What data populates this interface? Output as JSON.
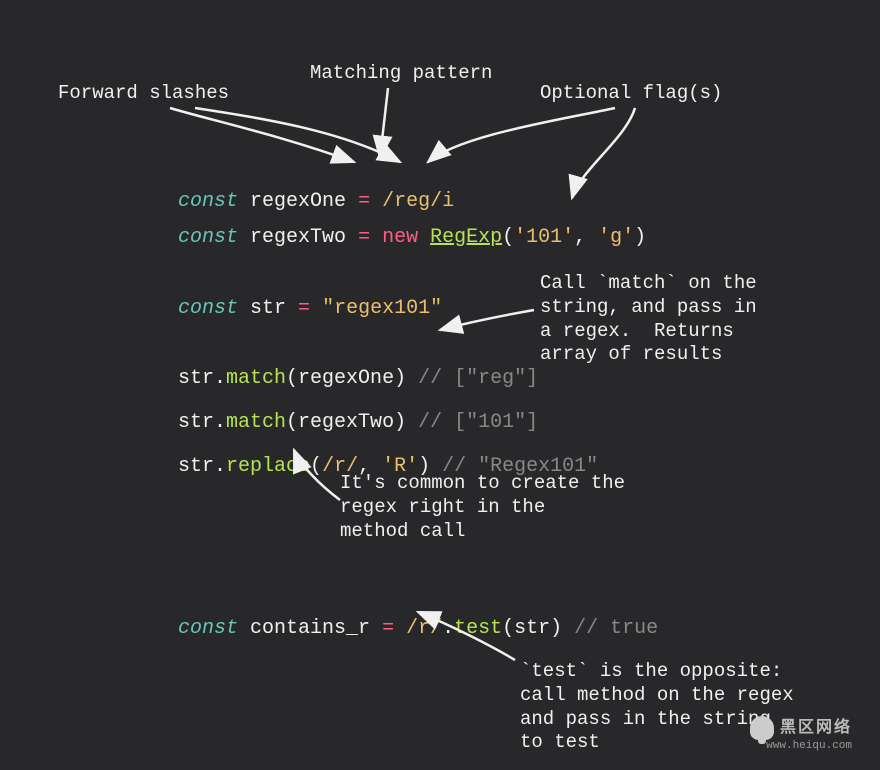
{
  "labels": {
    "forward_slashes": "Forward slashes",
    "matching_pattern": "Matching pattern",
    "optional_flags": "Optional flag(s)"
  },
  "notes": {
    "match": "Call `match` on the\nstring, and pass in\na regex.  Returns\narray of results",
    "inline": "It's common to create the\nregex right in the\nmethod call",
    "test": "`test` is the opposite:\ncall method on the regex\nand pass in the string\nto test"
  },
  "code": {
    "l1": {
      "const": "const",
      "name": " regexOne ",
      "eq": "= ",
      "regex": "/reg/i"
    },
    "l2": {
      "const": "const",
      "name": " regexTwo ",
      "eq": "= ",
      "new": "new ",
      "cls": "RegExp",
      "open": "(",
      "arg1": "'101'",
      "comma": ", ",
      "arg2": "'g'",
      "close": ")"
    },
    "l3": {
      "const": "const",
      "name": " str ",
      "eq": "= ",
      "val": "\"regex101\""
    },
    "l4": {
      "obj": "str.",
      "method": "match",
      "open": "(regexOne) ",
      "cmt": "// [\"reg\"]"
    },
    "l5": {
      "obj": "str.",
      "method": "match",
      "open": "(regexTwo) ",
      "cmt": "// [\"101\"]"
    },
    "l6": {
      "obj": "str.",
      "method": "replace",
      "open": "(",
      "regex": "/r/",
      "comma": ", ",
      "arg": "'R'",
      "close": ") ",
      "cmt": "// \"Regex101\""
    },
    "l7": {
      "const": "const",
      "name": " contains_r ",
      "eq": "= ",
      "regex": "/r/",
      "dot": ".",
      "method": "test",
      "open": "(str) ",
      "cmt": "// true"
    }
  },
  "watermark": {
    "cn": "黑区网络",
    "url": "www.heiqu.com"
  }
}
